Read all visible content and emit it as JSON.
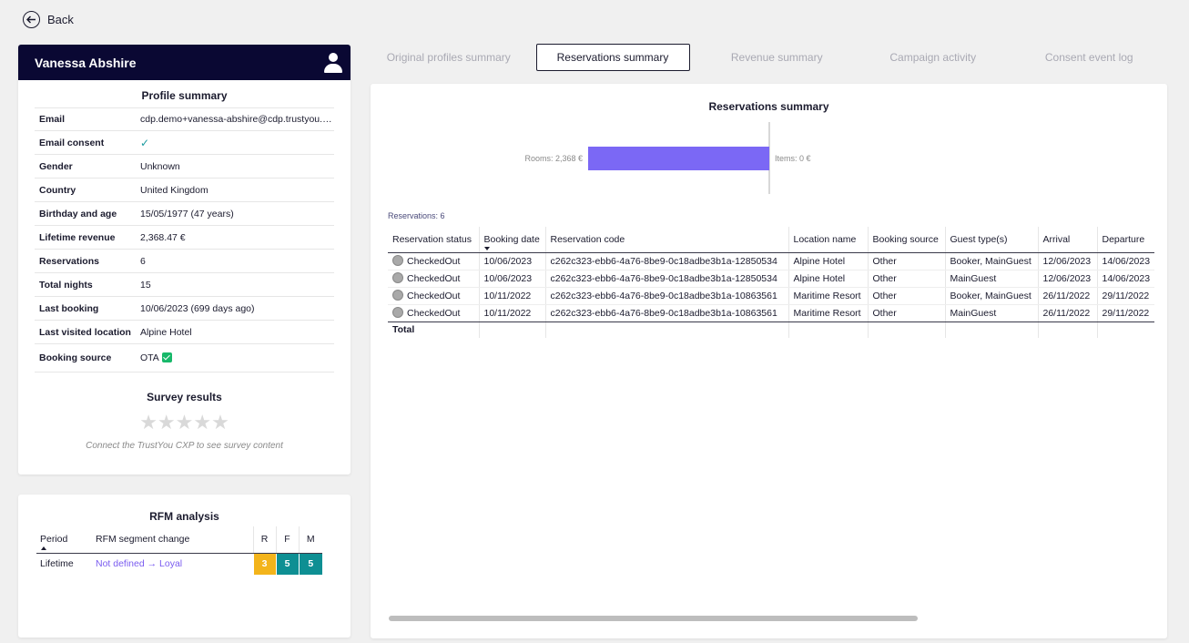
{
  "nav": {
    "back_label": "Back"
  },
  "profile": {
    "name": "Vanessa Abshire",
    "summary_title": "Profile summary",
    "fields": [
      {
        "label": "Email",
        "value": "cdp.demo+vanessa-abshire@cdp.trustyou.com"
      },
      {
        "label": "Email consent",
        "value": "✓"
      },
      {
        "label": "Gender",
        "value": "Unknown"
      },
      {
        "label": "Country",
        "value": "United Kingdom"
      },
      {
        "label": "Birthday and age",
        "value": "15/05/1977 (47 years)"
      },
      {
        "label": "Lifetime revenue",
        "value": "2,368.47 €"
      },
      {
        "label": "Reservations",
        "value": "6"
      },
      {
        "label": "Total nights",
        "value": "15"
      },
      {
        "label": "Last booking",
        "value": "10/06/2023 (699 days ago)"
      },
      {
        "label": "Last visited location",
        "value": "Alpine Hotel"
      },
      {
        "label": "Booking source",
        "value": "OTA"
      }
    ],
    "survey": {
      "title": "Survey results",
      "stars": "★★★★★",
      "rating": 0,
      "note": "Connect the TrustYou CXP to see survey content"
    }
  },
  "rfm": {
    "title": "RFM analysis",
    "headers": {
      "period": "Period",
      "segment": "RFM segment change",
      "r": "R",
      "f": "F",
      "m": "M"
    },
    "row": {
      "period": "Lifetime",
      "segment": "Not defined → Loyal",
      "r": "3",
      "f": "5",
      "m": "5"
    },
    "colors": {
      "r": "#f3b41b",
      "f": "#0e8f93",
      "m": "#0e8f93"
    }
  },
  "tabs": [
    {
      "label": "Original profiles summary",
      "active": false
    },
    {
      "label": "Reservations summary",
      "active": true
    },
    {
      "label": "Revenue summary",
      "active": false
    },
    {
      "label": "Campaign activity",
      "active": false
    },
    {
      "label": "Consent event log",
      "active": false
    }
  ],
  "reservations": {
    "chart_title": "Reservations summary",
    "count_label": "Reservations: 6",
    "columns": [
      "Reservation status",
      "Booking date",
      "Reservation code",
      "Location name",
      "Booking source",
      "Guest type(s)",
      "Arrival",
      "Departure"
    ],
    "rows": [
      [
        "CheckedOut",
        "10/06/2023",
        "c262c323-ebb6-4a76-8be9-0c18adbe3b1a-12850534",
        "Alpine Hotel",
        "Other",
        "Booker, MainGuest",
        "12/06/2023",
        "14/06/2023"
      ],
      [
        "CheckedOut",
        "10/06/2023",
        "c262c323-ebb6-4a76-8be9-0c18adbe3b1a-12850534",
        "Alpine Hotel",
        "Other",
        "MainGuest",
        "12/06/2023",
        "14/06/2023"
      ],
      [
        "CheckedOut",
        "10/11/2022",
        "c262c323-ebb6-4a76-8be9-0c18adbe3b1a-10863561",
        "Maritime Resort",
        "Other",
        "Booker, MainGuest",
        "26/11/2022",
        "29/11/2022"
      ],
      [
        "CheckedOut",
        "10/11/2022",
        "c262c323-ebb6-4a76-8be9-0c18adbe3b1a-10863561",
        "Maritime Resort",
        "Other",
        "MainGuest",
        "26/11/2022",
        "29/11/2022"
      ]
    ],
    "total_label": "Total"
  },
  "chart_data": {
    "type": "bar",
    "orientation": "horizontal-diverging",
    "categories": [
      "Rooms",
      "Items"
    ],
    "values": [
      2368,
      0
    ],
    "labels": [
      "Rooms: 2,368 €",
      "Items: 0 €"
    ],
    "title": "Reservations summary",
    "color": "#7b68f5"
  }
}
